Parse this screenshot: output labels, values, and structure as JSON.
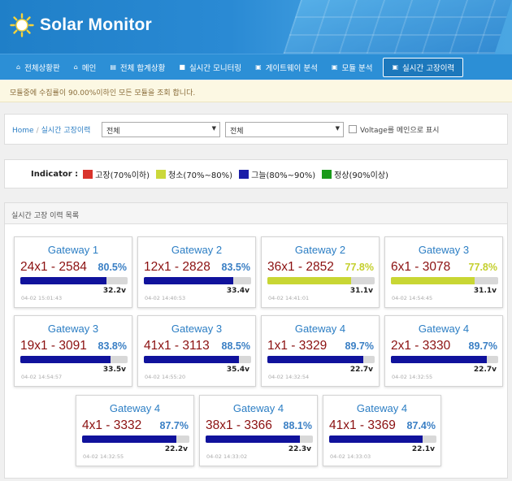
{
  "app": {
    "title": "Solar Monitor"
  },
  "nav": [
    {
      "label": "전체상황판",
      "icon": "home-icon"
    },
    {
      "label": "메인",
      "icon": "home-icon"
    },
    {
      "label": "전체 합계상황",
      "icon": "document-icon"
    },
    {
      "label": "실시간 모니터링",
      "icon": "video-icon"
    },
    {
      "label": "게이트웨이 분석",
      "icon": "modules-icon"
    },
    {
      "label": "모듈 분석",
      "icon": "modules-icon"
    },
    {
      "label": "실시간 고장이력",
      "icon": "modules-icon"
    }
  ],
  "notice": "모듈중에 수집률이 90.00%이하인 모든 모듈을 조회 합니다.",
  "breadcrumb": {
    "home": "Home",
    "current": "실시간 고장이력"
  },
  "filters": {
    "select1": "전체",
    "select2": "전체",
    "checkbox_label": "Voltage를 메인으로 표시"
  },
  "indicator": {
    "label": "Indicator :",
    "items": [
      {
        "label": "고장(70%이하)",
        "color": "#d9332c"
      },
      {
        "label": "청소(70%~80%)",
        "color": "#cbd83a"
      },
      {
        "label": "그늘(80%~90%)",
        "color": "#1b1ea8"
      },
      {
        "label": "정상(90%이상)",
        "color": "#1a9a1a"
      }
    ]
  },
  "panel": {
    "title": "실시간 고장 이력 목록"
  },
  "colors": {
    "yellow": "#c8d634",
    "blue": "#10129c",
    "pct_yellow": "#c4cf2d",
    "pct_blue": "#3a7fc4"
  },
  "cards": [
    {
      "gateway": "Gateway 1",
      "module": "24x1 - 2584",
      "pct": "80.5%",
      "level": 0.805,
      "volt": "32.2v",
      "time": "04-02 15:01:43",
      "status": "blue"
    },
    {
      "gateway": "Gateway 2",
      "module": "12x1 - 2828",
      "pct": "83.5%",
      "level": 0.835,
      "volt": "33.4v",
      "time": "04-02 14:40:53",
      "status": "blue"
    },
    {
      "gateway": "Gateway 2",
      "module": "36x1 - 2852",
      "pct": "77.8%",
      "level": 0.778,
      "volt": "31.1v",
      "time": "04-02 14:41:01",
      "status": "yellow"
    },
    {
      "gateway": "Gateway 3",
      "module": "6x1 - 3078",
      "pct": "77.8%",
      "level": 0.778,
      "volt": "31.1v",
      "time": "04-02 14:54:45",
      "status": "yellow"
    },
    {
      "gateway": "Gateway 3",
      "module": "19x1 - 3091",
      "pct": "83.8%",
      "level": 0.838,
      "volt": "33.5v",
      "time": "04-02 14:54:57",
      "status": "blue"
    },
    {
      "gateway": "Gateway 3",
      "module": "41x1 - 3113",
      "pct": "88.5%",
      "level": 0.885,
      "volt": "35.4v",
      "time": "04-02 14:55:20",
      "status": "blue"
    },
    {
      "gateway": "Gateway 4",
      "module": "1x1 - 3329",
      "pct": "89.7%",
      "level": 0.897,
      "volt": "22.7v",
      "time": "04-02 14:32:54",
      "status": "blue"
    },
    {
      "gateway": "Gateway 4",
      "module": "2x1 - 3330",
      "pct": "89.7%",
      "level": 0.897,
      "volt": "22.7v",
      "time": "04-02 14:32:55",
      "status": "blue"
    },
    {
      "gateway": "Gateway 4",
      "module": "4x1 - 3332",
      "pct": "87.7%",
      "level": 0.877,
      "volt": "22.2v",
      "time": "04-02 14:32:55",
      "status": "blue"
    },
    {
      "gateway": "Gateway 4",
      "module": "38x1 - 3366",
      "pct": "88.1%",
      "level": 0.881,
      "volt": "22.3v",
      "time": "04-02 14:33:02",
      "status": "blue"
    },
    {
      "gateway": "Gateway 4",
      "module": "41x1 - 3369",
      "pct": "87.4%",
      "level": 0.874,
      "volt": "22.1v",
      "time": "04-02 14:33:03",
      "status": "blue"
    }
  ]
}
